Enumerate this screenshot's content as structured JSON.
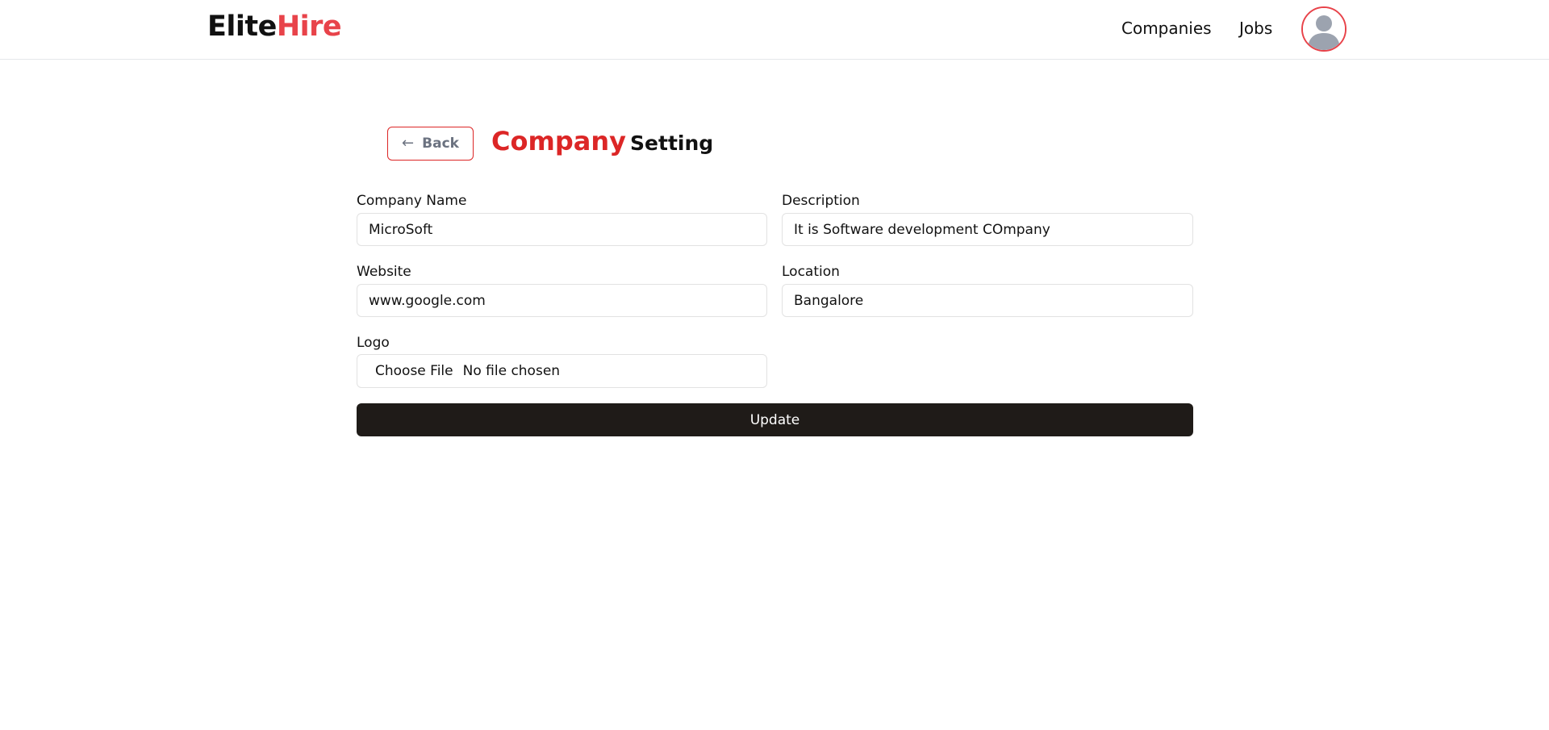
{
  "header": {
    "logo_part1": "Elite",
    "logo_part2": "Hire",
    "nav": {
      "companies": "Companies",
      "jobs": "Jobs"
    },
    "avatar_icon": "user-avatar-icon"
  },
  "title_row": {
    "back_label": "Back",
    "back_icon": "arrow-left-icon",
    "title_accent": "Company",
    "title_rest": "Setting"
  },
  "form": {
    "company_name": {
      "label": "Company Name",
      "value": "MicroSoft"
    },
    "description": {
      "label": "Description",
      "value": "It is Software development COmpany"
    },
    "website": {
      "label": "Website",
      "value": "www.google.com"
    },
    "location": {
      "label": "Location",
      "value": "Bangalore"
    },
    "logo": {
      "label": "Logo",
      "button": "Choose File",
      "status": "No file chosen"
    },
    "submit_label": "Update"
  },
  "colors": {
    "brand_red": "#dc2626",
    "logo_red": "#e8434a",
    "button_dark": "#1f1b18"
  }
}
